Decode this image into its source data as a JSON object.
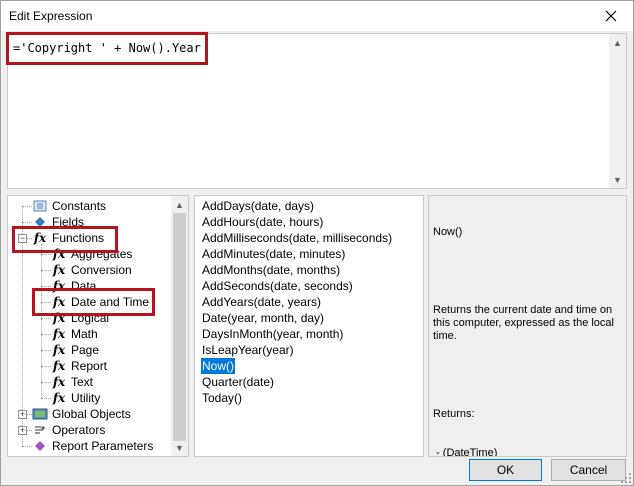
{
  "window": {
    "title": "Edit Expression"
  },
  "expression": {
    "value": "='Copyright ' + Now().Year"
  },
  "tree": {
    "items": [
      {
        "label": "Constants",
        "icon": "constants-icon",
        "level": 1,
        "expander": ""
      },
      {
        "label": "Fields",
        "icon": "fields-icon",
        "level": 1,
        "expander": ""
      },
      {
        "label": "Functions",
        "icon": "function-icon",
        "level": 1,
        "expander": "−"
      },
      {
        "label": "Aggregates",
        "icon": "function-icon",
        "level": 2,
        "expander": ""
      },
      {
        "label": "Conversion",
        "icon": "function-icon",
        "level": 2,
        "expander": ""
      },
      {
        "label": "Data",
        "icon": "function-icon",
        "level": 2,
        "expander": ""
      },
      {
        "label": "Date and Time",
        "icon": "function-icon",
        "level": 2,
        "expander": ""
      },
      {
        "label": "Logical",
        "icon": "function-icon",
        "level": 2,
        "expander": ""
      },
      {
        "label": "Math",
        "icon": "function-icon",
        "level": 2,
        "expander": ""
      },
      {
        "label": "Page",
        "icon": "function-icon",
        "level": 2,
        "expander": ""
      },
      {
        "label": "Report",
        "icon": "function-icon",
        "level": 2,
        "expander": ""
      },
      {
        "label": "Text",
        "icon": "function-icon",
        "level": 2,
        "expander": ""
      },
      {
        "label": "Utility",
        "icon": "function-icon",
        "level": 2,
        "expander": ""
      },
      {
        "label": "Global Objects",
        "icon": "global-objects-icon",
        "level": 1,
        "expander": "+"
      },
      {
        "label": "Operators",
        "icon": "operators-icon",
        "level": 1,
        "expander": "+"
      },
      {
        "label": "Report Parameters",
        "icon": "report-parameters-icon",
        "level": 1,
        "expander": ""
      }
    ]
  },
  "functions": {
    "items": [
      "AddDays(date, days)",
      "AddHours(date, hours)",
      "AddMilliseconds(date, milliseconds)",
      "AddMinutes(date, minutes)",
      "AddMonths(date, months)",
      "AddSeconds(date, seconds)",
      "AddYears(date, years)",
      "Date(year, month, day)",
      "DaysInMonth(year, month)",
      "IsLeapYear(year)",
      "Now()",
      "Quarter(date)",
      "Today()"
    ],
    "selected": "Now()"
  },
  "description": {
    "name": "Now()",
    "text": "Returns the current date and time on this computer, expressed as the local time.",
    "returns_label": "Returns:",
    "returns_value": " - (DateTime)"
  },
  "buttons": {
    "ok": "OK",
    "cancel": "Cancel"
  },
  "colors": {
    "highlight": "#b5141e",
    "selection": "#0078d7"
  }
}
